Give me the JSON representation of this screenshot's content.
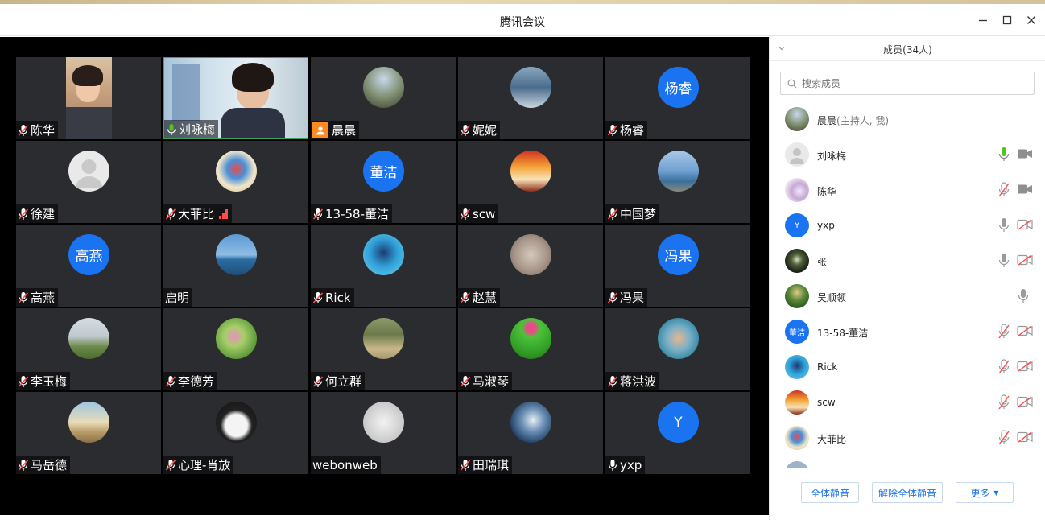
{
  "window": {
    "title": "腾讯会议"
  },
  "tiles": [
    {
      "name": "陈华",
      "mic": "muted"
    },
    {
      "name": "刘咏梅",
      "mic": "on"
    },
    {
      "name": "晨晨",
      "mic": "host"
    },
    {
      "name": "妮妮",
      "mic": "muted"
    },
    {
      "name": "杨睿",
      "mic": "muted",
      "avatar_text": "杨睿"
    },
    {
      "name": "徐建",
      "mic": "muted"
    },
    {
      "name": "大菲比",
      "mic": "muted"
    },
    {
      "name": "13-58-董洁",
      "mic": "muted",
      "avatar_text": "董洁"
    },
    {
      "name": "scw",
      "mic": "muted"
    },
    {
      "name": "中国梦",
      "mic": "muted"
    },
    {
      "name": "高燕",
      "mic": "muted",
      "avatar_text": "高燕"
    },
    {
      "name": "启明",
      "mic": "none"
    },
    {
      "name": "Rick",
      "mic": "muted"
    },
    {
      "name": "赵慧",
      "mic": "muted"
    },
    {
      "name": "冯果",
      "mic": "muted",
      "avatar_text": "冯果"
    },
    {
      "name": "李玉梅",
      "mic": "muted"
    },
    {
      "name": "李德芳",
      "mic": "muted"
    },
    {
      "name": "何立群",
      "mic": "muted"
    },
    {
      "name": "马淑琴",
      "mic": "muted"
    },
    {
      "name": "蒋洪波",
      "mic": "muted"
    },
    {
      "name": "马岳德",
      "mic": "muted"
    },
    {
      "name": "心理-肖放",
      "mic": "muted"
    },
    {
      "name": "webonweb",
      "mic": "none"
    },
    {
      "name": "田瑞琪",
      "mic": "muted"
    },
    {
      "name": "yxp",
      "mic": "on",
      "avatar_text": "Y"
    }
  ],
  "panel": {
    "title": "成员(34人)",
    "search_placeholder": "搜索成员",
    "members": [
      {
        "name": "晨晨",
        "role": "(主持人, 我)",
        "mic": "",
        "cam": ""
      },
      {
        "name": "刘咏梅",
        "role": "",
        "mic": "active",
        "cam": "on"
      },
      {
        "name": "陈华",
        "role": "",
        "mic": "muted",
        "cam": "on"
      },
      {
        "name": "yxp",
        "role": "",
        "mic": "on",
        "cam": "off",
        "avatar_text": "Y"
      },
      {
        "name": "张",
        "role": "",
        "mic": "on",
        "cam": "off"
      },
      {
        "name": "吴顺领",
        "role": "",
        "mic": "on",
        "cam": ""
      },
      {
        "name": "13-58-董洁",
        "role": "",
        "mic": "muted",
        "cam": "off",
        "avatar_text": "董洁"
      },
      {
        "name": "Rick",
        "role": "",
        "mic": "muted",
        "cam": "off"
      },
      {
        "name": "scw",
        "role": "",
        "mic": "muted",
        "cam": "off"
      },
      {
        "name": "大菲比",
        "role": "",
        "mic": "muted",
        "cam": "off"
      }
    ],
    "footer": {
      "mute_all": "全体静音",
      "unmute_all": "解除全体静音",
      "more": "更多"
    }
  },
  "colors": {
    "accent": "#1a73e8",
    "mute_red": "#ff4d4f",
    "speaking_green": "#52c41a",
    "avatar_blue": "#1a73f0"
  }
}
